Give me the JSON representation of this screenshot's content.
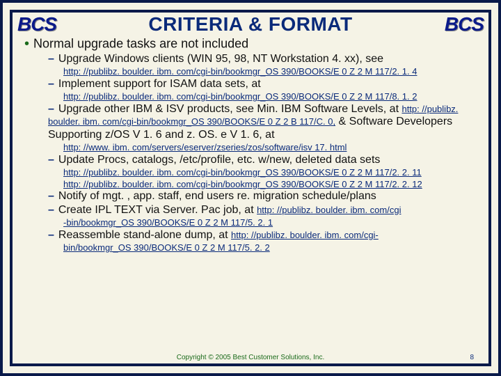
{
  "logo_text": "BCS",
  "title": "CRITERIA & FORMAT",
  "top_bullet": "Normal upgrade tasks are not included",
  "items": [
    {
      "text": "Upgrade Windows clients (WIN 95, 98, NT Workstation 4. xx), see",
      "urls": [
        "http: //publibz. boulder. ibm. com/cgi-bin/bookmgr_OS 390/BOOKS/E 0 Z 2 M 117/2. 1. 4"
      ]
    },
    {
      "text": "Implement support for ISAM data sets, at",
      "urls": [
        "http: //publibz. boulder. ibm. com/cgi-bin/bookmgr_OS 390/BOOKS/E 0 Z 2 M 117/8. 1. 2"
      ]
    },
    {
      "text_pre": "Upgrade other IBM & ISV products, see Min. IBM Software Levels, at ",
      "url_mid": "http: //publibz. boulder. ibm. com/cgi-bin/bookmgr_OS 390/BOOKS/E 0 Z 2 B 117/C. 0,",
      "text_mid": " & Software Developers Supporting z/OS V 1. 6 and z. OS. e V 1. 6, at",
      "url_end": "http: //www. ibm. com/servers/eserver/zseries/zos/software/isv 17. html"
    },
    {
      "text": "Update Procs, catalogs, /etc/profile, etc. w/new, deleted data sets",
      "urls": [
        "http: //publibz. boulder. ibm. com/cgi-bin/bookmgr_OS 390/BOOKS/E 0 Z 2 M 117/2. 2. 11",
        "http: //publibz. boulder. ibm. com/cgi-bin/bookmgr_OS 390/BOOKS/E 0 Z 2 M 117/2. 2. 12"
      ]
    },
    {
      "text": "Notify of mgt. , app. staff, end users re. migration schedule/plans",
      "urls": []
    },
    {
      "text_pre": "Create IPL TEXT via Server. Pac job, at ",
      "url_inline": "http: //publibz. boulder. ibm. com/cgi",
      "url_cont": "-bin/bookmgr_OS 390/BOOKS/E 0 Z 2 M 117/5. 2. 1"
    },
    {
      "text_pre": "Reassemble stand-alone dump, at ",
      "url_inline": "http: //publibz. boulder. ibm. com/cgi-",
      "url_cont": "bin/bookmgr_OS 390/BOOKS/E 0 Z 2 M 117/5. 2. 2"
    }
  ],
  "footer": "Copyright © 2005 Best Customer Solutions, Inc.",
  "page_num": "8"
}
